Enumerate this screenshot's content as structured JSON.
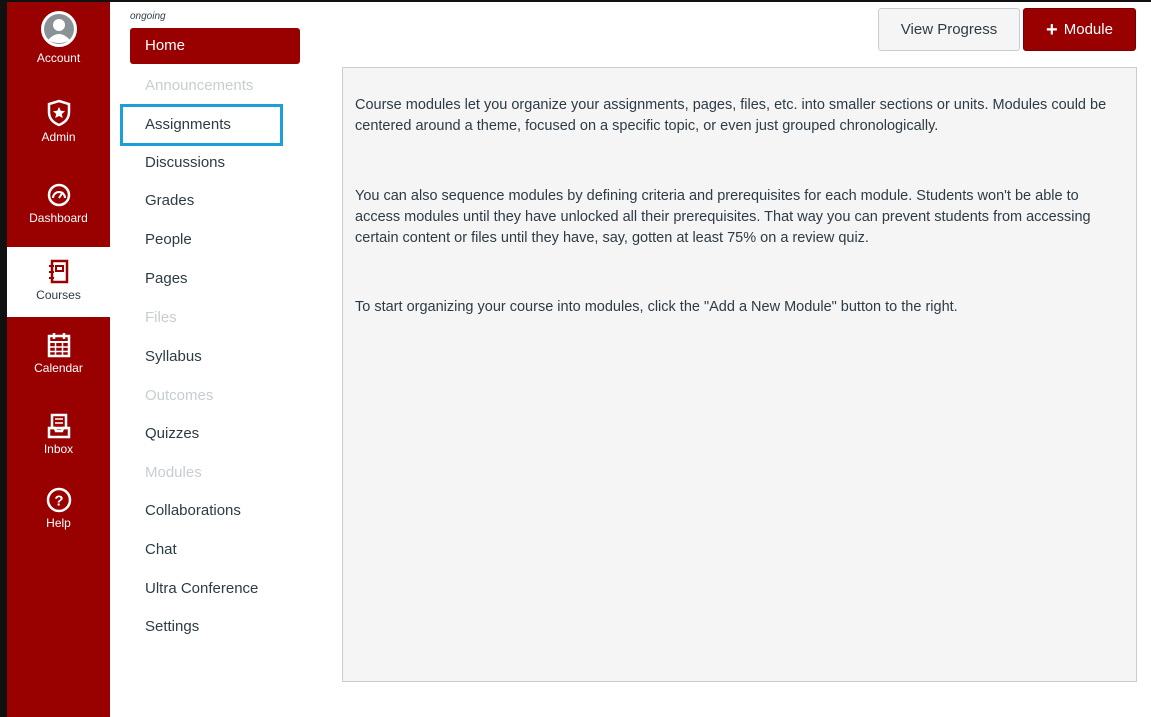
{
  "global_nav": {
    "items": [
      {
        "label": "Account",
        "icon": "account-avatar-icon"
      },
      {
        "label": "Admin",
        "icon": "admin-shield-icon"
      },
      {
        "label": "Dashboard",
        "icon": "dashboard-gauge-icon"
      },
      {
        "label": "Courses",
        "icon": "courses-book-icon",
        "active": true
      },
      {
        "label": "Calendar",
        "icon": "calendar-icon"
      },
      {
        "label": "Inbox",
        "icon": "inbox-icon"
      },
      {
        "label": "Help",
        "icon": "help-icon"
      }
    ]
  },
  "course_nav": {
    "term": "ongoing",
    "items": [
      {
        "label": "Home",
        "state": "active"
      },
      {
        "label": "Announcements",
        "state": "disabled"
      },
      {
        "label": "Assignments",
        "state": "highlighted"
      },
      {
        "label": "Discussions",
        "state": "normal"
      },
      {
        "label": "Grades",
        "state": "normal"
      },
      {
        "label": "People",
        "state": "normal"
      },
      {
        "label": "Pages",
        "state": "normal"
      },
      {
        "label": "Files",
        "state": "disabled"
      },
      {
        "label": "Syllabus",
        "state": "normal"
      },
      {
        "label": "Outcomes",
        "state": "disabled"
      },
      {
        "label": "Quizzes",
        "state": "normal"
      },
      {
        "label": "Modules",
        "state": "disabled"
      },
      {
        "label": "Collaborations",
        "state": "normal"
      },
      {
        "label": "Chat",
        "state": "normal"
      },
      {
        "label": "Ultra Conference",
        "state": "normal"
      },
      {
        "label": "Settings",
        "state": "normal"
      }
    ]
  },
  "header": {
    "view_progress_label": "View Progress",
    "add_module_label": "Module",
    "add_module_icon": "plus-icon"
  },
  "main": {
    "paragraphs": [
      "Course modules let you organize your assignments, pages, files, etc. into smaller sections or units. Modules could be centered around a theme, focused on a specific topic, or even just grouped chronologically.",
      "You can also sequence modules by defining criteria and prerequisites for each module. Students won't be able to access modules until they have unlocked all their prerequisites. That way you can prevent students from accessing certain content or files until they have, say, gotten at least 75% on a review quiz.",
      "To start organizing your course into modules, click the \"Add a New Module\" button to the right."
    ]
  },
  "colors": {
    "brand": "#990000",
    "highlight_outline": "#1c9fd8",
    "panel_bg": "#f5f5f5",
    "disabled_text": "#c7cdd1"
  }
}
